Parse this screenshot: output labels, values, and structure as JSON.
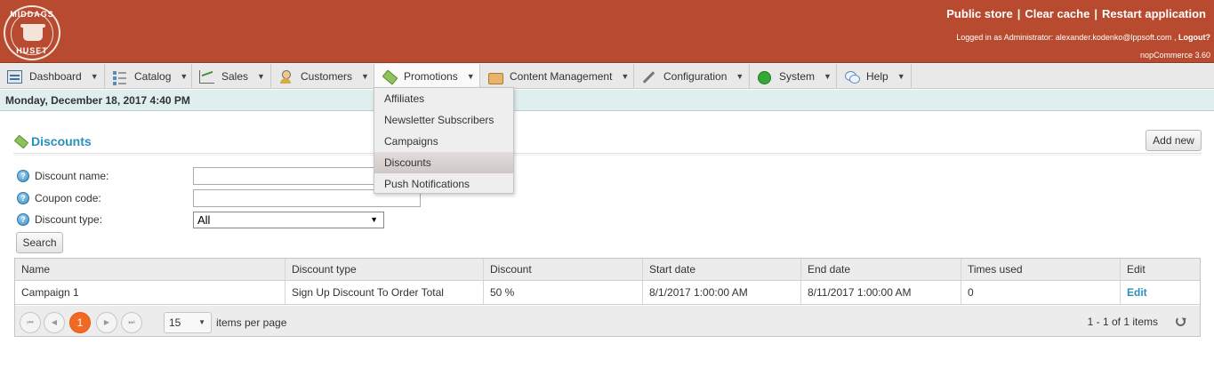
{
  "header": {
    "logo_top_text": "MIDDAGS",
    "logo_bottom_text": "HUSET",
    "links": [
      "Public store",
      "Clear cache",
      "Restart application"
    ],
    "login_text": "Logged in as Administrator: alexander.kodenko@lppsoft.com ,",
    "logout_label": "Logout?",
    "version": "nopCommerce 3.60"
  },
  "menu": {
    "items": [
      {
        "label": "Dashboard",
        "icon": "dashboard-icon"
      },
      {
        "label": "Catalog",
        "icon": "catalog-icon"
      },
      {
        "label": "Sales",
        "icon": "sales-icon"
      },
      {
        "label": "Customers",
        "icon": "customers-icon"
      },
      {
        "label": "Promotions",
        "icon": "promotions-icon"
      },
      {
        "label": "Content Management",
        "icon": "content-icon"
      },
      {
        "label": "Configuration",
        "icon": "wrench-icon"
      },
      {
        "label": "System",
        "icon": "system-icon"
      },
      {
        "label": "Help",
        "icon": "help-icon"
      }
    ],
    "promotions_dropdown": [
      "Affiliates",
      "Newsletter Subscribers",
      "Campaigns",
      "Discounts",
      "Push Notifications"
    ],
    "hovered_item": "Discounts"
  },
  "date_bar": "Monday, December 18, 2017 4:40 PM",
  "page": {
    "title": "Discounts",
    "add_new_label": "Add new"
  },
  "search": {
    "discount_name_label": "Discount name:",
    "discount_name_value": "",
    "coupon_code_label": "Coupon code:",
    "coupon_code_value": "",
    "discount_type_label": "Discount type:",
    "discount_type_value": "All",
    "search_button": "Search",
    "help_glyph": "?"
  },
  "grid": {
    "columns": [
      "Name",
      "Discount type",
      "Discount",
      "Start date",
      "End date",
      "Times used",
      "Edit"
    ],
    "rows": [
      [
        "Campaign 1",
        "Sign Up Discount To Order Total",
        "50 %",
        "8/1/2017 1:00:00 AM",
        "8/11/2017 1:00:00 AM",
        "0",
        "Edit"
      ]
    ]
  },
  "pager": {
    "first": "⏮",
    "prev": "◀",
    "current_page": "1",
    "next": "▶",
    "last": "⏭",
    "page_size": "15",
    "per_page_label": "items per page",
    "items_info": "1 - 1 of 1 items"
  },
  "colors": {
    "header_bg": "#b84a2f",
    "accent": "#2a8fbd",
    "current_page": "#f26a22"
  }
}
